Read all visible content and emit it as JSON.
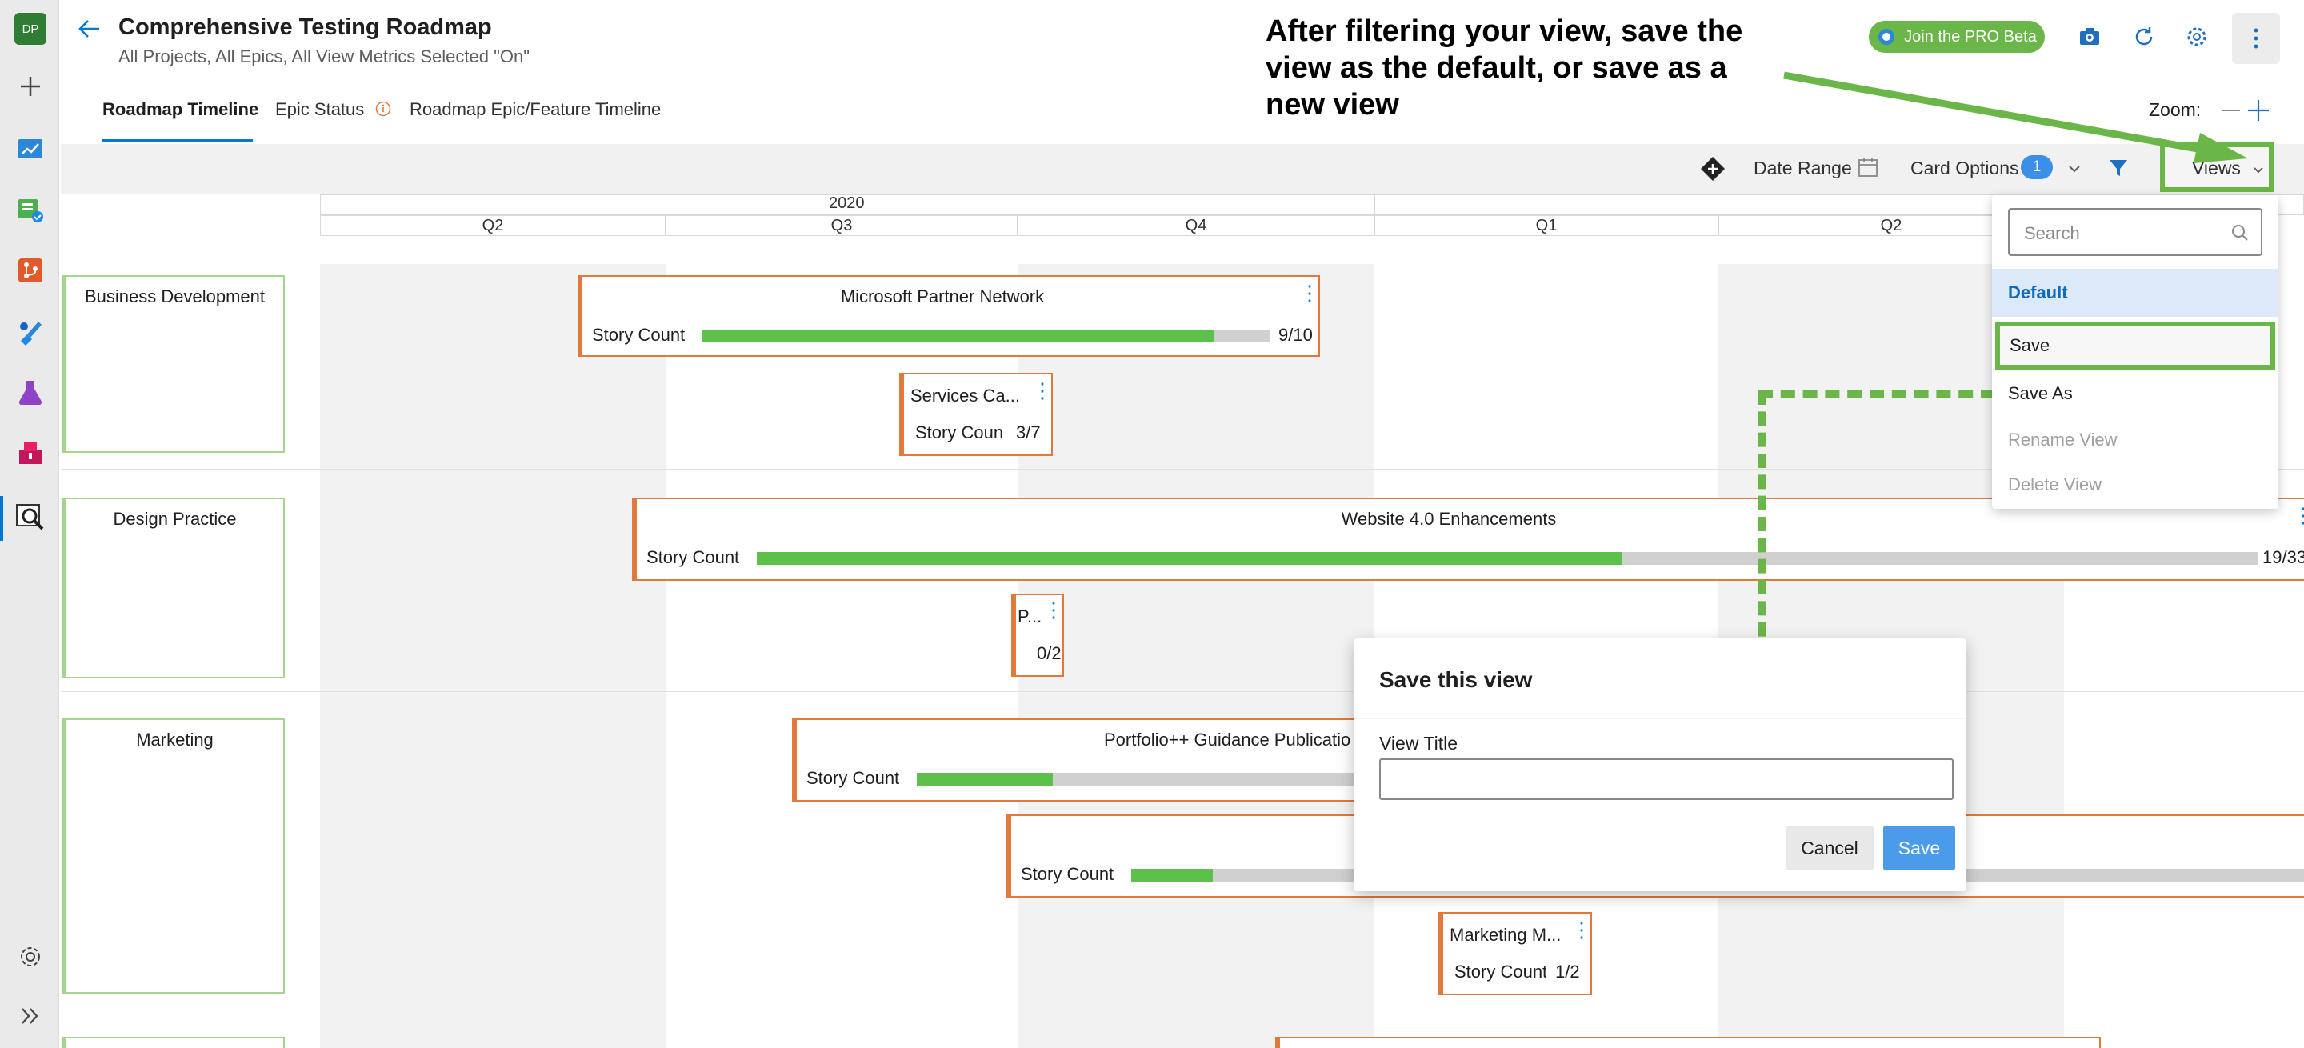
{
  "header": {
    "title": "Comprehensive Testing Roadmap",
    "subtitle": "All Projects, All Epics, All View Metrics Selected \"On\"",
    "pro_beta_label": "Join the PRO Beta"
  },
  "annotation": "After filtering your view, save the view as the default, or save as a new view",
  "rail": {
    "avatar_initials": "DP"
  },
  "tabs": [
    {
      "label": "Roadmap Timeline",
      "active": true
    },
    {
      "label": "Epic Status",
      "active": false
    },
    {
      "label": "Roadmap Epic/Feature Timeline",
      "active": false
    }
  ],
  "zoom": {
    "label": "Zoom:"
  },
  "toolbar": {
    "date_range_label": "Date Range",
    "card_options_label": "Card Options",
    "card_options_count": "1",
    "views_label": "Views"
  },
  "timeline": {
    "year": "2020",
    "quarters": [
      "Q2",
      "Q3",
      "Q4",
      "Q1",
      "Q2"
    ]
  },
  "lanes": [
    {
      "label": "Business Development"
    },
    {
      "label": "Design Practice"
    },
    {
      "label": "Marketing"
    }
  ],
  "cards": [
    {
      "title": "Microsoft Partner Network",
      "metric": "Story Count",
      "count": "9/10",
      "progress": 0.9
    },
    {
      "title": "Services Ca...",
      "metric": "Story Coun",
      "count": "3/7"
    },
    {
      "title": "Website 4.0 Enhancements",
      "metric": "Story Count",
      "count": "19/33",
      "progress": 0.576
    },
    {
      "title": "P...",
      "count": "0/2"
    },
    {
      "title": "Portfolio++ Guidance Publicatio",
      "metric": "Story Count"
    },
    {
      "metric": "Story Count"
    },
    {
      "title": "Marketing M...",
      "metric": "Story Count",
      "count": "1/2"
    }
  ],
  "views_dropdown": {
    "search_placeholder": "Search",
    "default_item": "Default",
    "save": "Save",
    "save_as": "Save As",
    "rename": "Rename View",
    "delete": "Delete View"
  },
  "dialog": {
    "title": "Save this view",
    "field_label": "View Title",
    "field_value": "",
    "cancel_label": "Cancel",
    "save_label": "Save"
  },
  "colors": {
    "accent_green": "#6bb648",
    "card_border": "#e07a3a",
    "progress_fill": "#5cc04a",
    "primary_blue": "#0078d4"
  }
}
